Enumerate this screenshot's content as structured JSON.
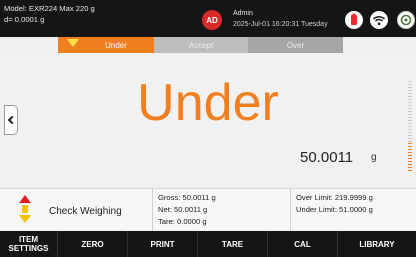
{
  "status_bar": {
    "model_line": "Model: EXR224   Max 220 g",
    "resolution_line": "d= 0.0001 g",
    "user_initials": "AD",
    "user_name": "Admin",
    "timestamp": "2025-Jul-01 16:20:31 Tuesday",
    "icons": [
      "usb-icon",
      "wifi-icon",
      "calibration-icon"
    ],
    "icon_colors": {
      "usb": "#e03030",
      "wifi": "#2a2a2a",
      "calibration": "#4a7a3a"
    }
  },
  "tabs": [
    {
      "label": "Under",
      "active": true
    },
    {
      "label": "Accept",
      "active": false
    },
    {
      "label": "Over",
      "active": false
    }
  ],
  "display": {
    "status_word": "Under",
    "status_color": "#f07f1f",
    "weight": "50.0011",
    "unit": "g",
    "bar_fill_fraction": 0.3
  },
  "info": {
    "mode": "Check Weighing",
    "gross": "Gross: 50.0011 g",
    "net": "Net: 50.0011 g",
    "tare": "Tare: 0.0000 g",
    "over_limit": "Over Limit: 219.9999 g",
    "under_limit": "Under Limit: 51.0000 g"
  },
  "buttons": {
    "item_settings": "ITEM SETTINGS",
    "zero": "ZERO",
    "print": "PRINT",
    "tare": "TARE",
    "cal": "CAL",
    "library": "LIBRARY"
  }
}
